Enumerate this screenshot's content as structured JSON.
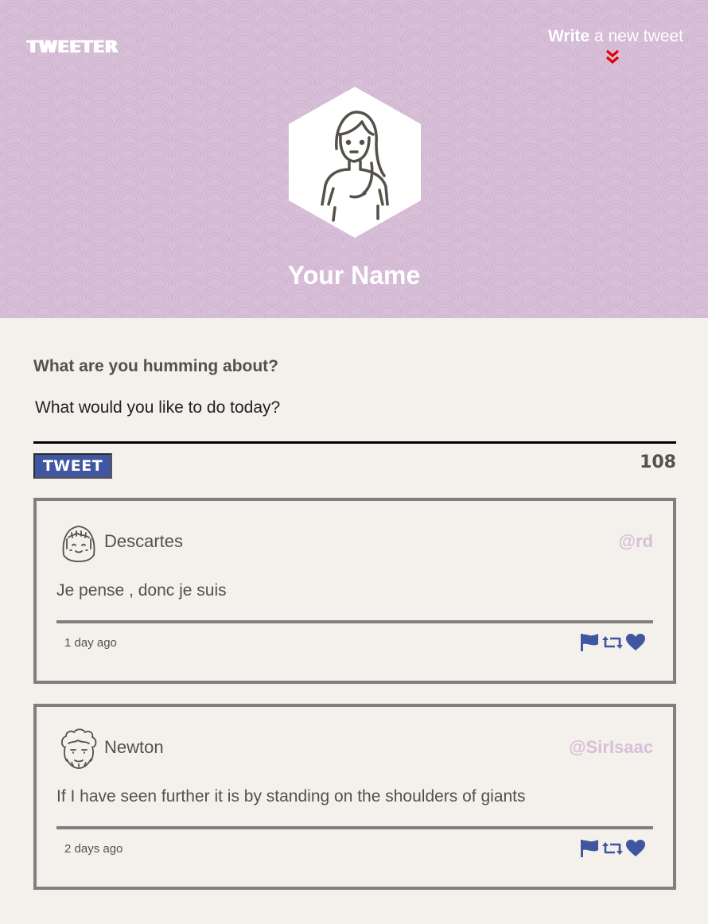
{
  "nav": {
    "brand": "TWEETER",
    "write_bold": "Write",
    "write_rest": " a new tweet"
  },
  "profile": {
    "name": "Your Name"
  },
  "composer": {
    "label": "What are you humming about?",
    "placeholder": "What would you like to do today?",
    "button_label": "TWEET",
    "counter": "108"
  },
  "tweets": [
    {
      "name": "Descartes",
      "handle": "@rd",
      "text": "Je pense , donc je suis",
      "time": "1 day ago"
    },
    {
      "name": "Newton",
      "handle": "@SirIsaac",
      "text": "If I have seen further it is by standing on the shoulders of giants",
      "time": "2 days ago"
    }
  ],
  "colors": {
    "header_bg": "#d8bfd8",
    "page_bg": "#f4f1ec",
    "accent_blue": "#4056a1",
    "chevron_red": "#e00000",
    "text_dark": "#545149",
    "card_border": "#808080"
  },
  "icons": {
    "write_chevron": "double-chevron-down-icon",
    "actions": [
      "flag-icon",
      "retweet-icon",
      "heart-icon"
    ]
  }
}
